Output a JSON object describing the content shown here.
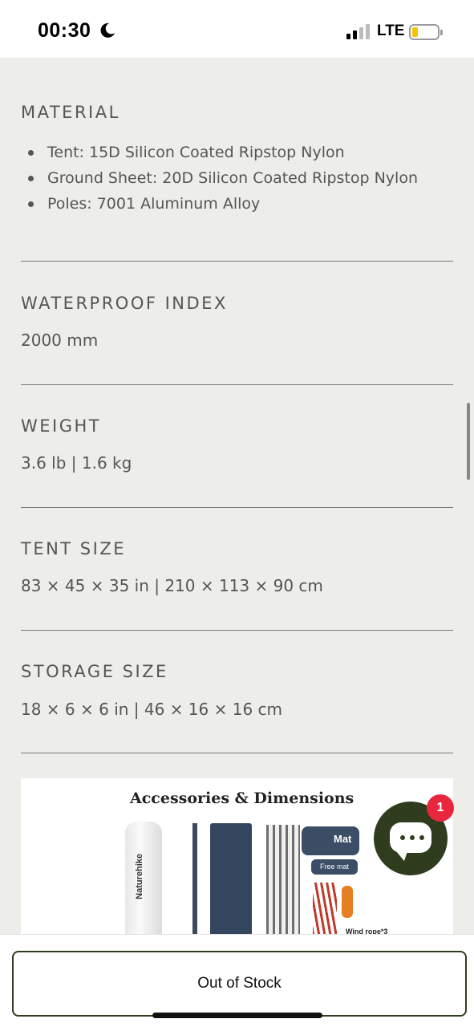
{
  "status_bar": {
    "time": "00:30",
    "network": "LTE",
    "icons": [
      "moon-icon",
      "signal-icon",
      "battery-icon"
    ],
    "battery_level_fraction": 0.2
  },
  "specs": {
    "material": {
      "title": "MATERIAL",
      "items": [
        "Tent: 15D Silicon Coated Ripstop Nylon",
        "Ground Sheet: 20D Silicon Coated Ripstop Nylon",
        "Poles: 7001 Aluminum Alloy"
      ]
    },
    "waterproof": {
      "title": "WATERPROOF INDEX",
      "value": "2000 mm"
    },
    "weight": {
      "title": "WEIGHT",
      "value": "3.6 lb | 1.6 kg"
    },
    "tent_size": {
      "title": "TENT SIZE",
      "value": "83 × 45 × 35 in | 210 × 113 × 90 cm"
    },
    "storage_size": {
      "title": "STORAGE SIZE",
      "value": "18 × 6 × 6 in | 46 × 16 × 16 cm"
    }
  },
  "product_image": {
    "title": "Accessories & Dimensions",
    "brand": "Naturehike",
    "mat_label": "Mat",
    "free_mat_label": "Free mat",
    "wind_rope_label": "Wind rope*3"
  },
  "chat": {
    "badge_count": "1",
    "icon": "chat-bubble-icon",
    "accent_color": "#2f3d1e",
    "badge_color": "#e8273f"
  },
  "footer": {
    "button_label": "Out of Stock"
  }
}
